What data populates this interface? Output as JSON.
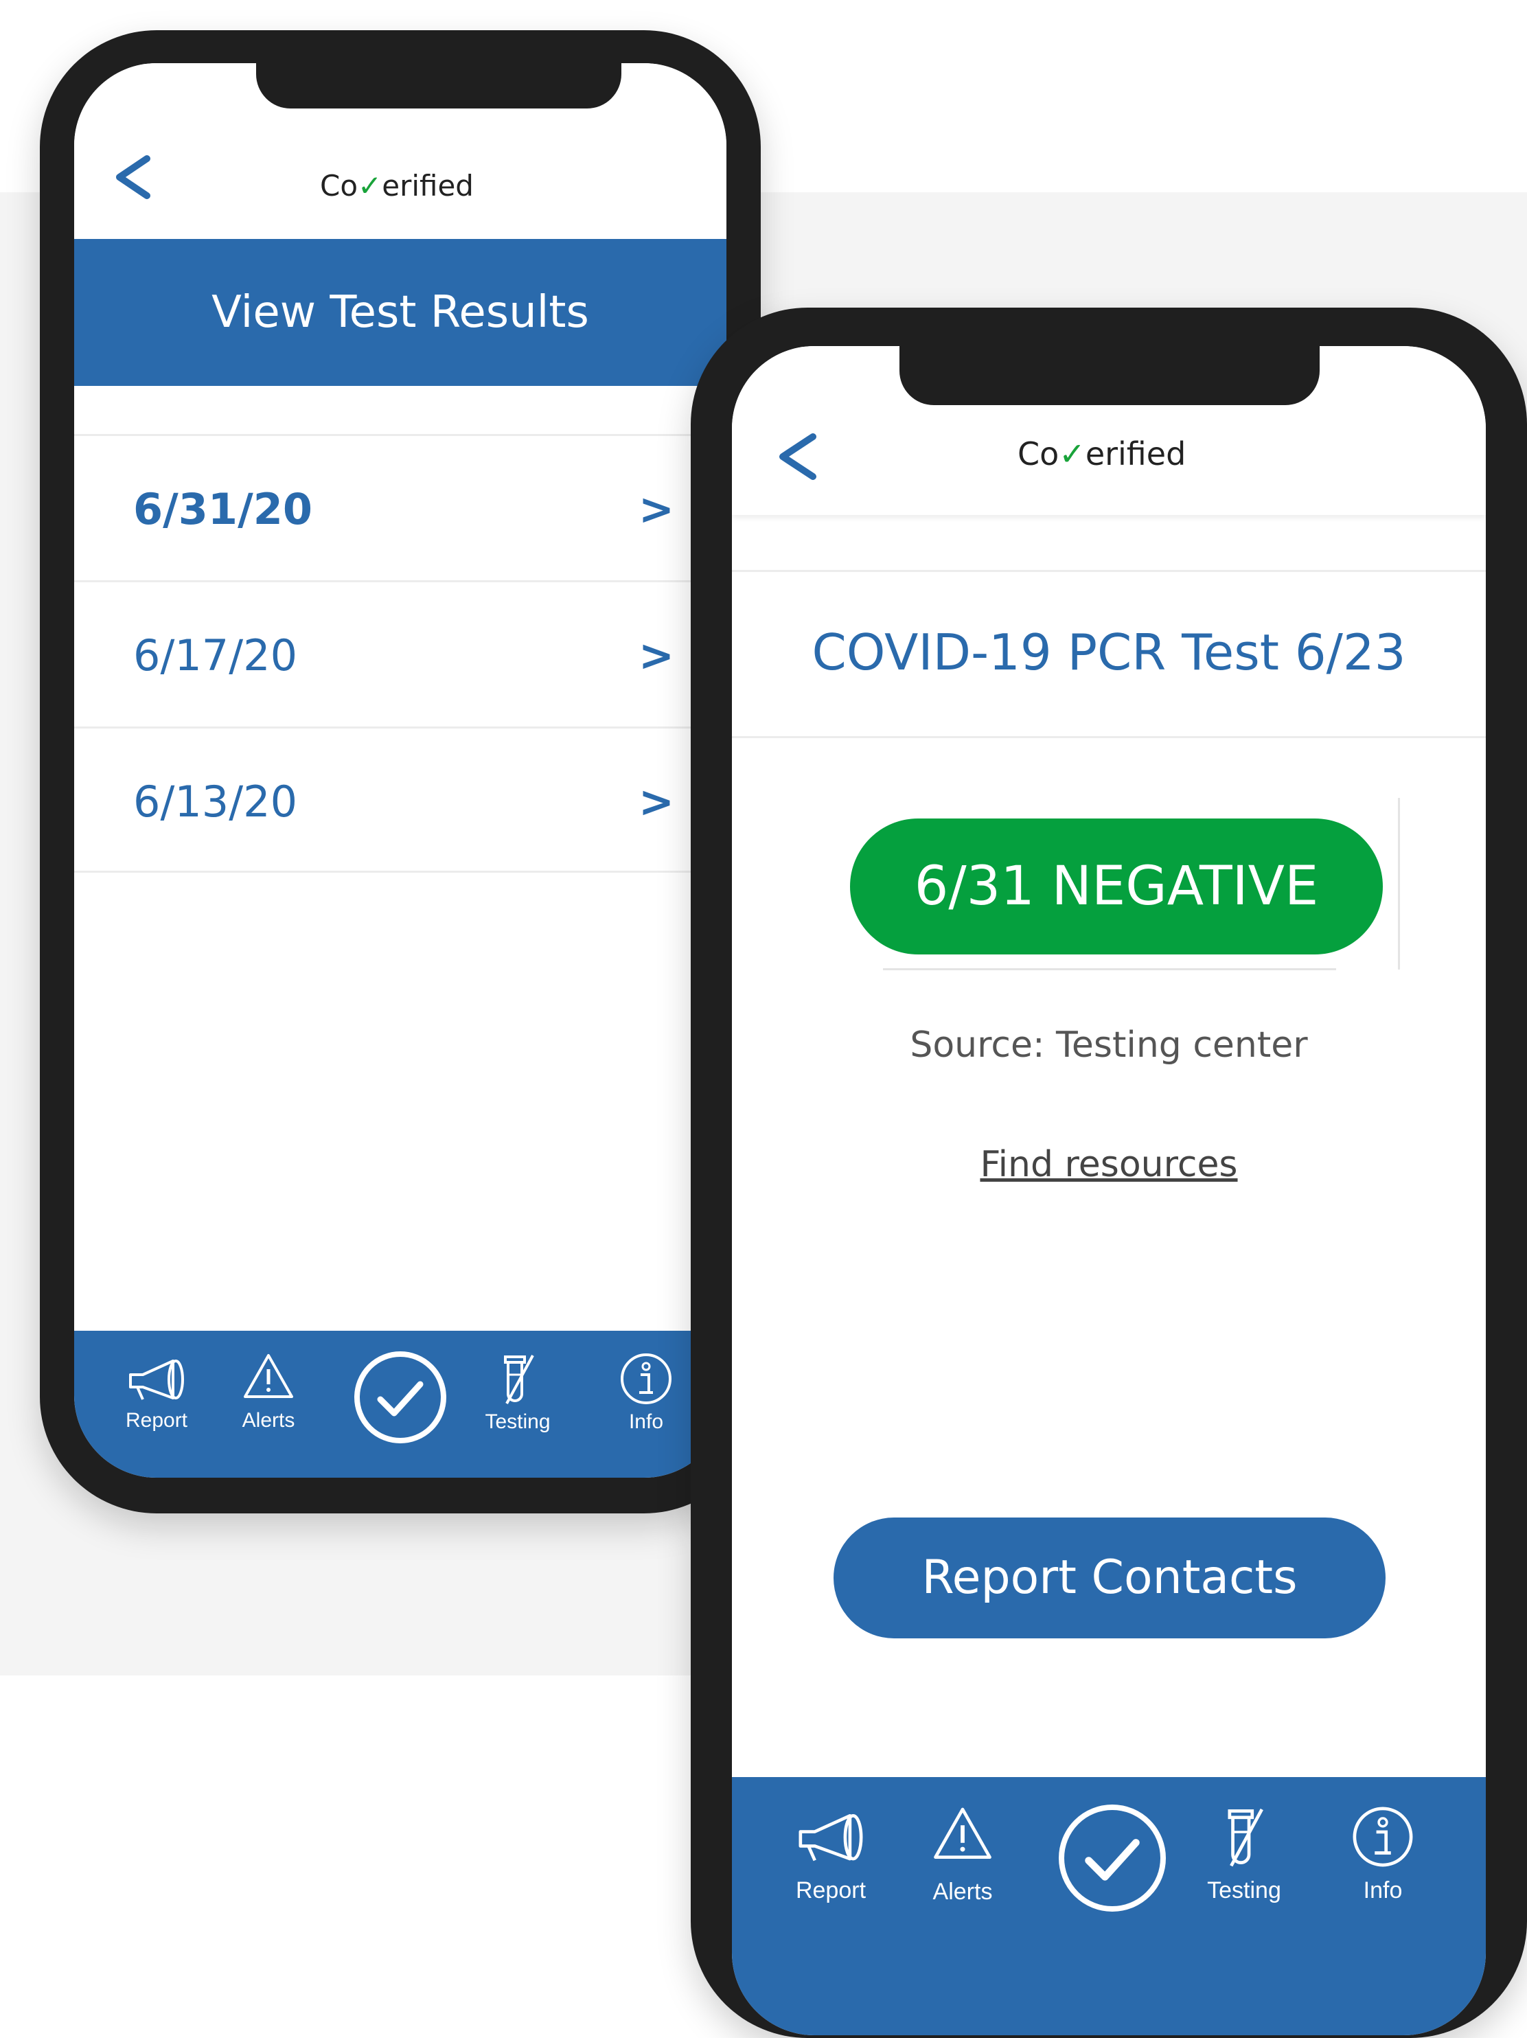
{
  "left_phone": {
    "logo": {
      "prefix": "Co",
      "mark": "✓",
      "suffix": "erified"
    },
    "back_icon": "chevron-left-icon",
    "title": "View Test Results",
    "results": [
      {
        "date": "6/31/20",
        "chevron": ">"
      },
      {
        "date": "6/17/20",
        "chevron": ">"
      },
      {
        "date": "6/13/20",
        "chevron": ">"
      }
    ],
    "tabs": [
      {
        "label": "Report",
        "icon": "megaphone-icon"
      },
      {
        "label": "Alerts",
        "icon": "warning-icon"
      },
      {
        "label": "",
        "icon": "check-circle-icon"
      },
      {
        "label": "Testing",
        "icon": "test-tube-icon"
      },
      {
        "label": "Info",
        "icon": "info-icon"
      }
    ]
  },
  "right_phone": {
    "logo": {
      "prefix": "Co",
      "mark": "✓",
      "suffix": "erified"
    },
    "back_icon": "chevron-left-icon",
    "test_title": "COVID-19  PCR Test 6/23",
    "result": "6/31  NEGATIVE",
    "source": "Source: Testing center",
    "link": "Find resources",
    "cta": "Report Contacts",
    "tabs": [
      {
        "label": "Report",
        "icon": "megaphone-icon"
      },
      {
        "label": "Alerts",
        "icon": "warning-icon"
      },
      {
        "label": "",
        "icon": "check-circle-icon"
      },
      {
        "label": "Testing",
        "icon": "test-tube-icon"
      },
      {
        "label": "Info",
        "icon": "info-icon"
      }
    ]
  },
  "colors": {
    "brand_blue": "#2a6aac",
    "negative_green": "#05a03e",
    "logo_check": "#19a33a"
  }
}
